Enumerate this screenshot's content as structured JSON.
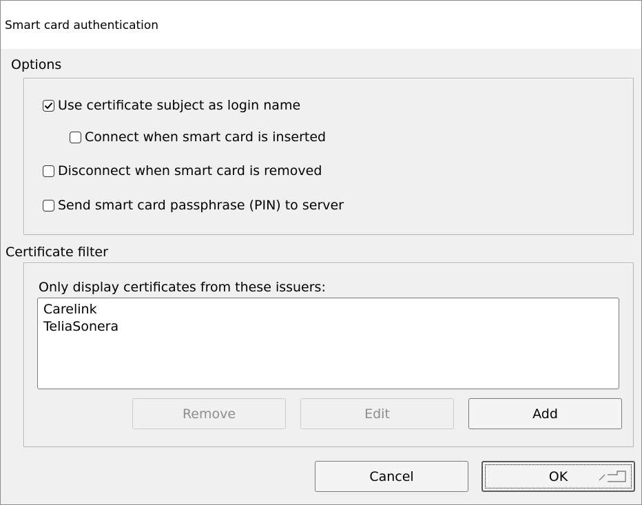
{
  "window": {
    "title": "Smart card authentication"
  },
  "options": {
    "label": "Options",
    "checkboxes": [
      {
        "label": "Use certificate subject as login name",
        "checked": true
      },
      {
        "label": "Connect when smart card is inserted",
        "checked": false
      },
      {
        "label": "Disconnect when smart card is removed",
        "checked": false
      },
      {
        "label": "Send smart card passphrase (PIN) to server",
        "checked": false
      }
    ]
  },
  "certificate_filter": {
    "label": "Certificate filter",
    "list_label": "Only display certificates from these issuers:",
    "issuers": [
      "Carelink",
      "TeliaSonera"
    ],
    "remove_label": "Remove",
    "edit_label": "Edit",
    "add_label": "Add"
  },
  "footer": {
    "cancel_label": "Cancel",
    "ok_label": "OK"
  },
  "icons": {
    "check": "checkmark-icon",
    "enter": "enter-key-icon"
  }
}
